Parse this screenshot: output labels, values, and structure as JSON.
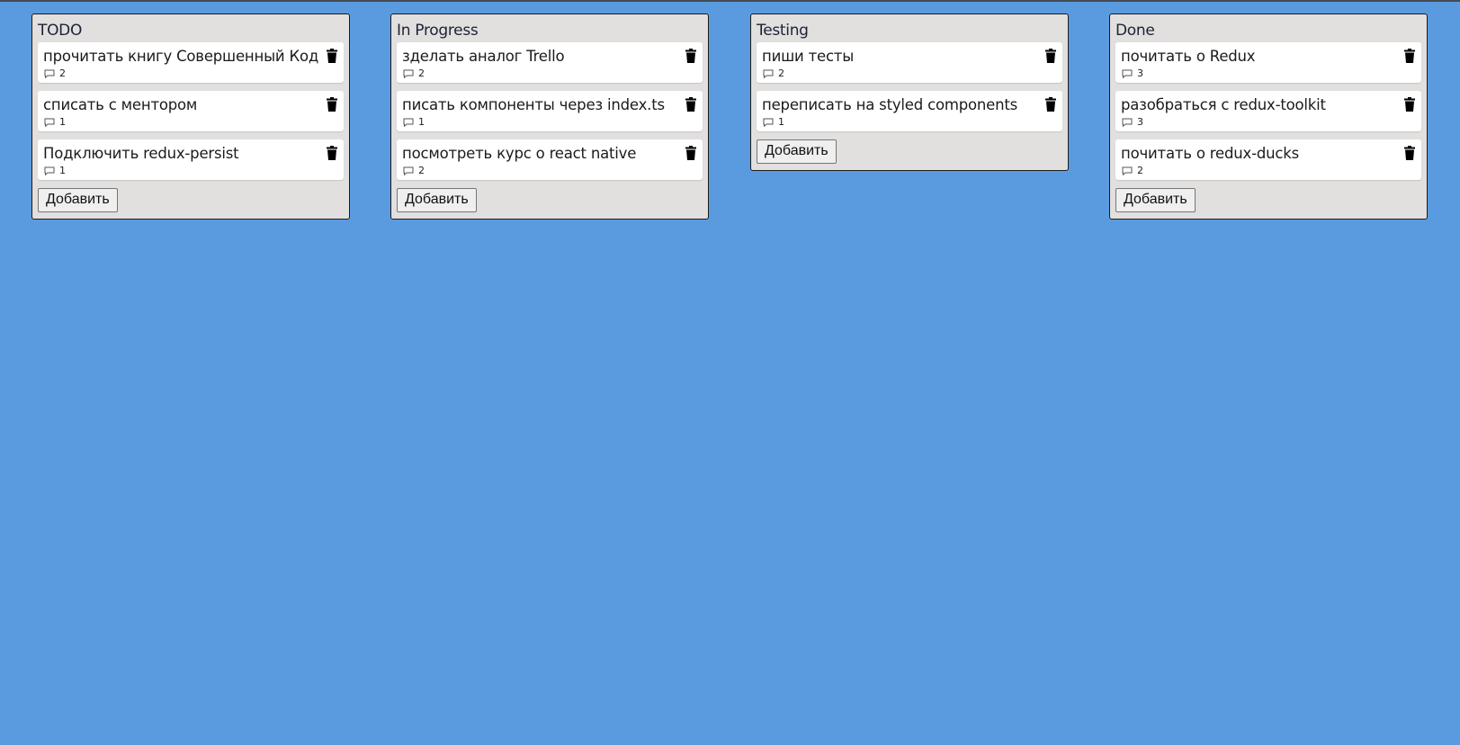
{
  "board": {
    "columns": [
      {
        "title": "TODO",
        "add_label": "Добавить",
        "cards": [
          {
            "title": "прочитать книгу Совершенный Код",
            "comments": "2"
          },
          {
            "title": "списать с ментором",
            "comments": "1"
          },
          {
            "title": "Подключить redux-persist",
            "comments": "1"
          }
        ]
      },
      {
        "title": "In Progress",
        "add_label": "Добавить",
        "cards": [
          {
            "title": "зделать аналог Trello",
            "comments": "2"
          },
          {
            "title": "писать компоненты через index.ts",
            "comments": "1"
          },
          {
            "title": "посмотреть курс о react native",
            "comments": "2"
          }
        ]
      },
      {
        "title": "Testing",
        "add_label": "Добавить",
        "cards": [
          {
            "title": "пиши тесты",
            "comments": "2"
          },
          {
            "title": "переписать на styled components",
            "comments": "1"
          }
        ]
      },
      {
        "title": "Done",
        "add_label": "Добавить",
        "cards": [
          {
            "title": "почитать о Redux",
            "comments": "3"
          },
          {
            "title": "разобраться с redux-toolkit",
            "comments": "3"
          },
          {
            "title": "почитать о redux-ducks",
            "comments": "2"
          }
        ]
      }
    ]
  },
  "icons": {
    "delete": "trash-icon",
    "comments": "comment-icon"
  },
  "colors": {
    "background": "#5a9be0",
    "column": "#e2dfdf",
    "card": "#ffffff"
  }
}
